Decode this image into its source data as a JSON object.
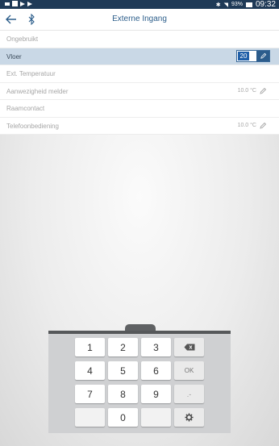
{
  "status_bar": {
    "battery_text": "93%",
    "time": "09:32"
  },
  "header": {
    "title": "Externe Ingang",
    "back_icon": "arrow-left-icon",
    "bluetooth_icon": "bluetooth-icon"
  },
  "list": {
    "items": [
      {
        "label": "Ongebruikt",
        "value": ""
      },
      {
        "label": "Vloer",
        "value": "20"
      },
      {
        "label": "Ext. Temperatuur",
        "value": ""
      },
      {
        "label": "Aanwezigheid melder",
        "value": "10.0 °C"
      },
      {
        "label": "Raamcontact",
        "value": ""
      },
      {
        "label": "Telefoonbediening",
        "value": "10.0 °C"
      }
    ]
  },
  "keypad": {
    "keys": [
      "1",
      "2",
      "3",
      "4",
      "5",
      "6",
      "7",
      "8",
      "9",
      "0"
    ],
    "ok_label": "OK",
    "dash_label": ".-",
    "backspace_icon": "backspace-icon",
    "settings_icon": "gear-icon"
  }
}
